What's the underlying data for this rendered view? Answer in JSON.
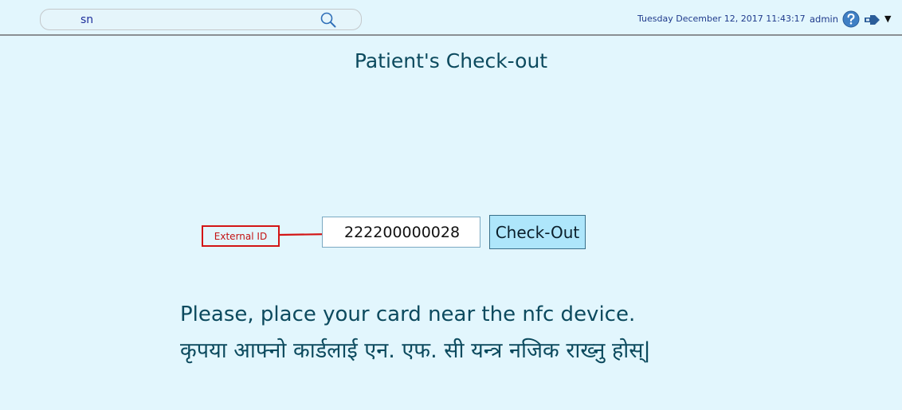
{
  "header": {
    "search": {
      "value": "sn",
      "placeholder": ""
    },
    "datetime": "Tuesday December 12, 2017 11:43:17",
    "user": "admin",
    "icons": [
      "search-icon",
      "help-icon",
      "logout-icon",
      "chevron-down-icon"
    ]
  },
  "main": {
    "title": "Patient's Check-out",
    "annotation": {
      "label": "External ID"
    },
    "external_id_input": {
      "value": "222200000028"
    },
    "checkout_button": {
      "label": "Check-Out"
    },
    "instructions": {
      "english": "Please, place your card near the nfc device.",
      "nepali": "कृपया आफ्नो कार्डलाई एन. एफ. सी यन्त्र नजिक राख्नु होस्|"
    }
  },
  "colors": {
    "background": "#e2f6fd",
    "title_text": "#0c4a5e",
    "button_bg": "#aee6fb",
    "annotation_red": "#d31515",
    "header_text": "#1f3a8c"
  }
}
